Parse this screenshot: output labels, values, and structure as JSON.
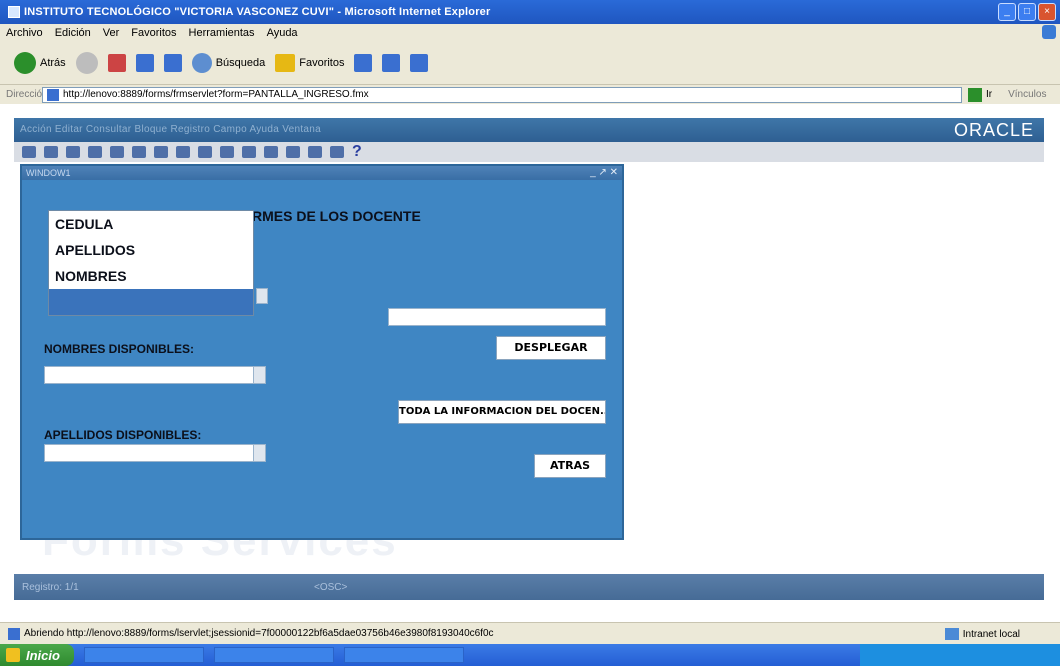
{
  "window": {
    "title": "INSTITUTO TECNOLÓGICO \"VICTORIA VASCONEZ CUVI\" - Microsoft Internet Explorer"
  },
  "menubar": [
    "Archivo",
    "Edición",
    "Ver",
    "Favoritos",
    "Herramientas",
    "Ayuda"
  ],
  "toolbar": {
    "back_label": "Atrás",
    "search_label": "Búsqueda",
    "favorites_label": "Favoritos"
  },
  "address": {
    "label": "Dirección",
    "url": "http://lenovo:8889/forms/frmservlet?form=PANTALLA_INGRESO.fmx",
    "go_label": "Ir",
    "links_label": "Vínculos"
  },
  "oracle": {
    "menu_text": "Acción  Editar  Consultar  Bloque  Registro  Campo  Ayuda  Ventana",
    "logo": "ORACLE",
    "help_glyph": "?",
    "watermark": "Forms Services",
    "record_text": "Registro: 1/1",
    "osc_text": "<OSC>"
  },
  "form": {
    "window_title": "WINDOW1",
    "window_controls": "_ ↗ ✕",
    "header": "RMES DE LOS  DOCENTE",
    "dropdown_options": [
      "CEDULA",
      "APELLIDOS",
      "NOMBRES",
      ""
    ],
    "nombres_label": "NOMBRES DISPONIBLES:",
    "apellidos_label": "APELLIDOS DISPONIBLES:",
    "buttons": {
      "desplegar": "DESPLEGAR",
      "toda": "TODA LA INFORMACION DEL DOCEN...",
      "atras": "ATRAS"
    }
  },
  "statusbar": {
    "text": "Abriendo http://lenovo:8889/forms/lservlet;jsessionid=7f00000122bf6a5dae03756b46e3980f8193040c6f0c",
    "zone": "Intranet local"
  },
  "taskbar": {
    "start_label": "Inicio"
  }
}
